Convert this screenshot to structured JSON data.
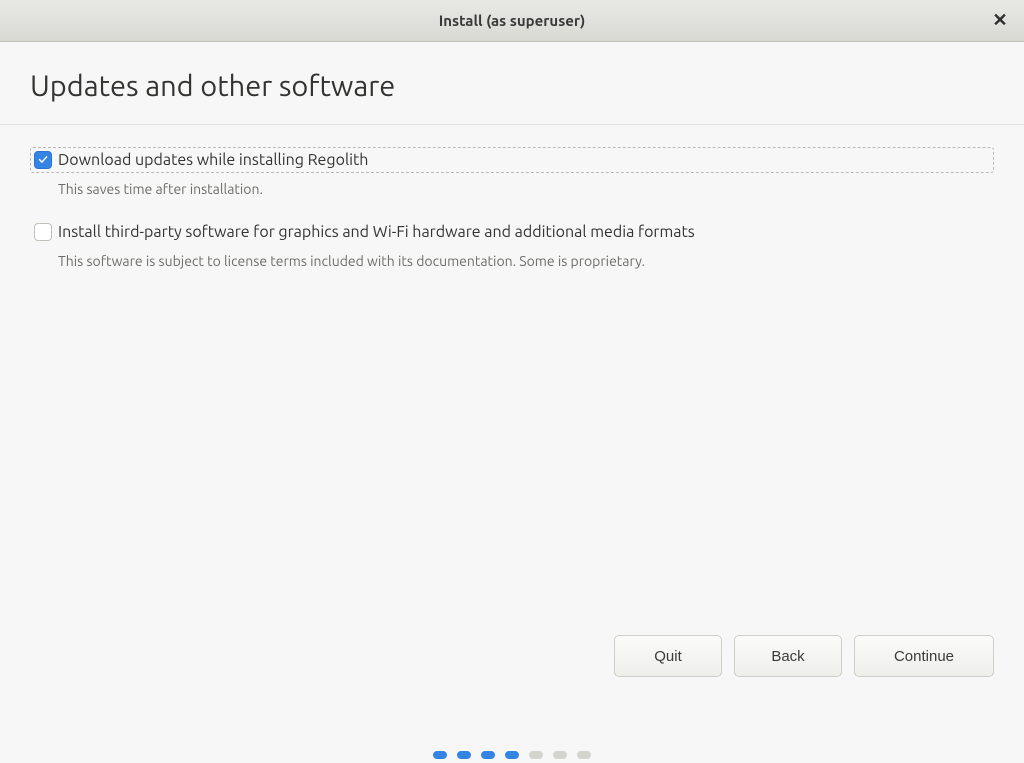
{
  "titlebar": {
    "title": "Install (as superuser)",
    "close_glyph": "✕"
  },
  "header": {
    "page_title": "Updates and other software"
  },
  "options": {
    "download_updates": {
      "label": "Download updates while installing Regolith",
      "description": "This saves time after installation.",
      "checked": true,
      "focused": true
    },
    "third_party": {
      "label": "Install third-party software for graphics and Wi-Fi hardware and additional media formats",
      "description": "This software is subject to license terms included with its documentation. Some is proprietary.",
      "checked": false,
      "focused": false
    }
  },
  "buttons": {
    "quit": "Quit",
    "back": "Back",
    "continue": "Continue"
  },
  "steps": {
    "total": 7,
    "active": [
      true,
      true,
      true,
      true,
      false,
      false,
      false
    ]
  }
}
